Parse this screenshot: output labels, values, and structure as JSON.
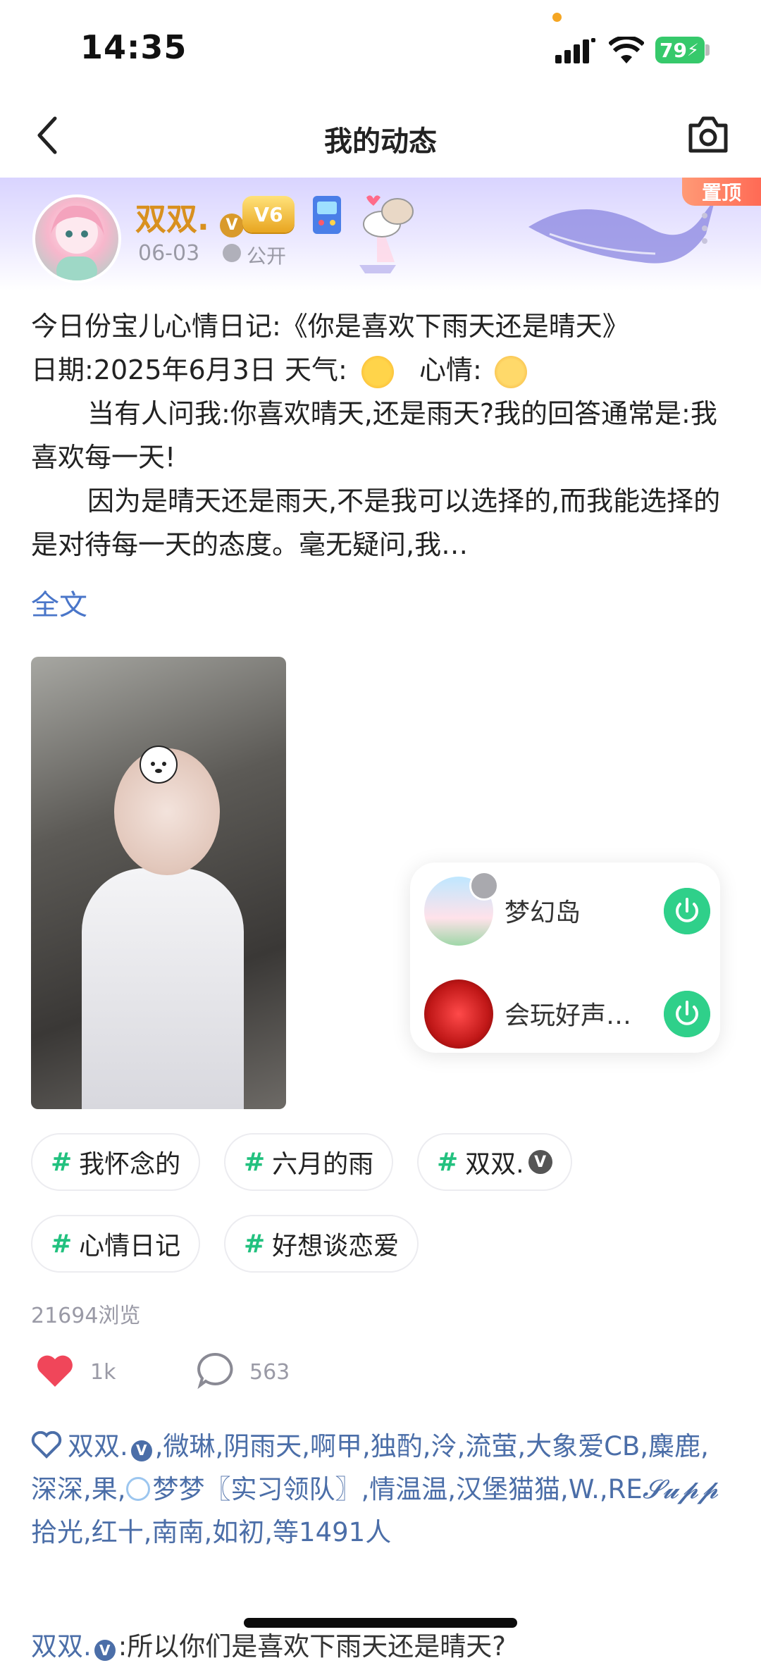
{
  "status_bar": {
    "time": "14:35",
    "battery": "79"
  },
  "nav": {
    "title": "我的动态"
  },
  "post": {
    "pin_label": "置顶",
    "author": "双双.",
    "verified_mark": "V",
    "level_badge": "V6",
    "date": "06-03",
    "visibility": "公开",
    "text_lines": [
      "今日份宝儿心情日记:《你是喜欢下雨天还是晴天》",
      "日期:2025年6月3日  天气:",
      "心情:",
      "当有人问我:你喜欢晴天,还是雨天?我的回答通常是:我喜欢每一天!",
      "因为是晴天还是雨天,不是我可以选择的,而我能选择的是对待每一天的态度。毫无疑问,我…"
    ],
    "full_text_link": "全文"
  },
  "floating_games": [
    {
      "name": "梦幻岛"
    },
    {
      "name": "会玩好声…"
    }
  ],
  "tags": [
    "我怀念的",
    "六月的雨",
    "双双.",
    "心情日记",
    "好想谈恋爱"
  ],
  "tag_hash": "#",
  "views": "21694浏览",
  "actions": {
    "likes": "1k",
    "comments": "563"
  },
  "likers": {
    "text_a": "双双.",
    "text_b": ",微琳,阴雨天,啊甲,独酌,泠,流萤,大象爱CB,麋鹿,深深,果,",
    "text_c": "梦梦〖实习领队〗,情温温,汉堡猫猫,W.,RE",
    "text_d": "𝓢𝓾𝓹𝓹",
    "text_e": "拾光,红十,南南,如初,等1491人"
  },
  "comment_preview": {
    "name": "双双.",
    "text": ":所以你们是喜欢下雨天还是晴天?"
  },
  "colors": {
    "accent_green": "#22c17f",
    "link_blue": "#4a76c9",
    "author_gold": "#d8901e",
    "like_red": "#f0465a"
  }
}
